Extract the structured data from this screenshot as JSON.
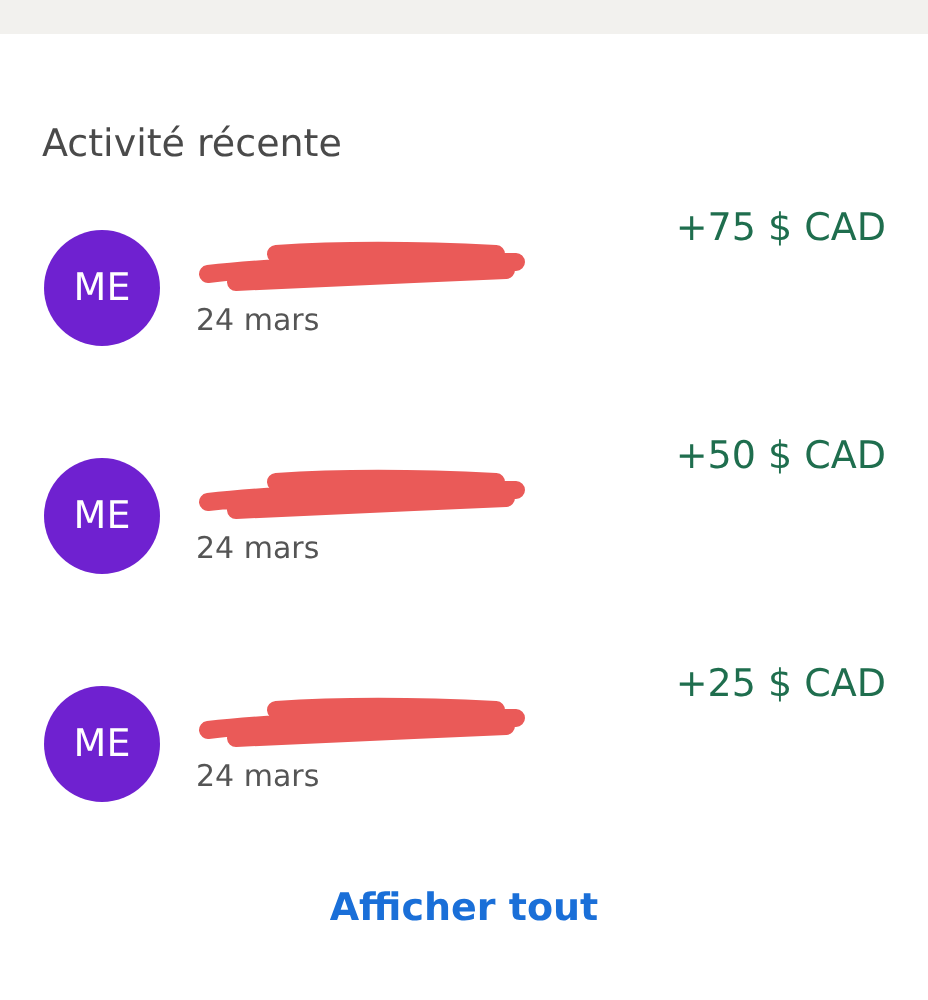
{
  "section_title": "Activité récente",
  "transactions": [
    {
      "initials": "ME",
      "date": "24 mars",
      "amount": "+75 $ CAD"
    },
    {
      "initials": "ME",
      "date": "24 mars",
      "amount": "+50 $ CAD"
    },
    {
      "initials": "ME",
      "date": "24 mars",
      "amount": "+25 $ CAD"
    }
  ],
  "show_all_link": "Afficher tout"
}
